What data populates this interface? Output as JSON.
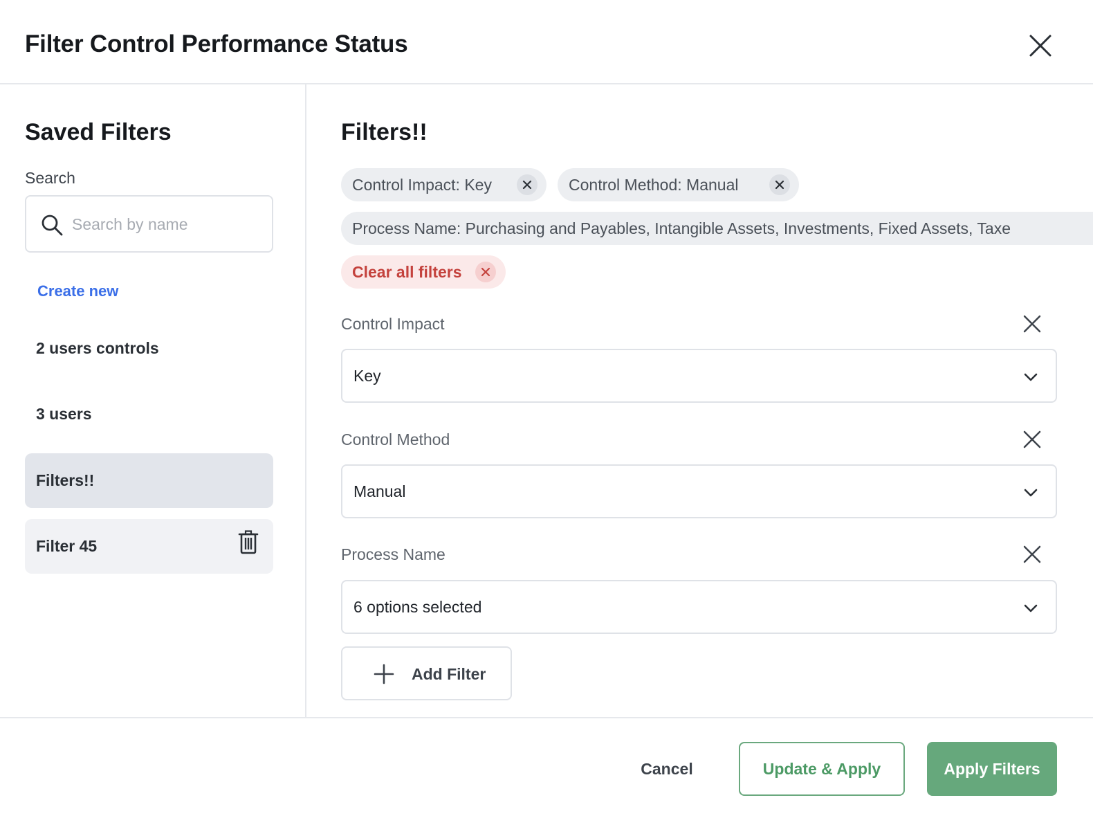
{
  "modal": {
    "title": "Filter Control Performance Status"
  },
  "sidebar": {
    "title": "Saved Filters",
    "search_label": "Search",
    "search_placeholder": "Search by name",
    "search_value": "",
    "create_new": "Create new",
    "items": [
      {
        "label": "2 users controls",
        "selected": false
      },
      {
        "label": "3 users",
        "selected": false
      },
      {
        "label": "Filters!!",
        "selected": true
      },
      {
        "label": "Filter 45",
        "selected": false,
        "has_delete": true
      }
    ]
  },
  "main": {
    "title": "Filters!!",
    "chips": [
      {
        "label": "Control Impact: Key"
      },
      {
        "label": "Control Method: Manual"
      },
      {
        "label": "Process Name: Purchasing and Payables, Intangible Assets, Investments, Fixed Assets, Taxe"
      }
    ],
    "clear_all": "Clear all filters",
    "fields": [
      {
        "label": "Control Impact",
        "value": "Key"
      },
      {
        "label": "Control Method",
        "value": "Manual"
      },
      {
        "label": "Process Name",
        "value": "6 options selected"
      }
    ],
    "add_filter": "Add Filter"
  },
  "footer": {
    "cancel": "Cancel",
    "update_apply": "Update & Apply",
    "apply": "Apply Filters"
  },
  "colors": {
    "accent_link": "#3b6fe8",
    "primary_green": "#66a87c",
    "danger": "#c4423d",
    "selected_item_bg": "#e2e5eb"
  },
  "icons": [
    "close-icon",
    "search-icon",
    "trash-icon",
    "chevron-down-icon",
    "plus-icon"
  ]
}
